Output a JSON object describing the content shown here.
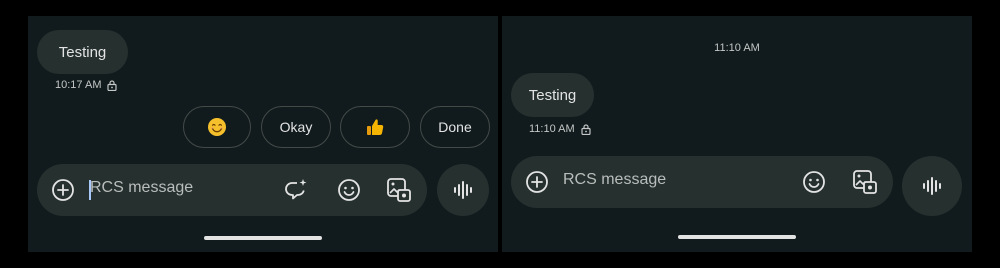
{
  "left": {
    "message": {
      "text": "Testing",
      "time": "10:17 AM"
    },
    "suggestions": [
      {
        "label": "😊",
        "icon": "smile-emoji"
      },
      {
        "label": "Okay"
      },
      {
        "label": "👍",
        "icon": "thumbs-up-emoji"
      },
      {
        "label": "Done"
      }
    ],
    "composer": {
      "placeholder": "RCS message",
      "icons": [
        "add-circle-icon",
        "ai-sparkle-chat-icon",
        "emoji-icon",
        "gallery-icon"
      ]
    },
    "voice_icon": "voice-waveform-icon"
  },
  "right": {
    "timestamp_header": "11:10 AM",
    "message": {
      "text": "Testing",
      "time": "11:10 AM"
    },
    "composer": {
      "placeholder": "RCS message",
      "icons": [
        "add-circle-icon",
        "emoji-icon",
        "gallery-icon"
      ]
    },
    "voice_icon": "voice-waveform-icon"
  },
  "colors": {
    "panel_bg": "#111b1d",
    "bubble_bg": "#25302f",
    "text": "#e3e3e3",
    "secondary_text": "#c4c7c5",
    "cursor": "#a8c7fa",
    "thumbs_up": "#f5b400"
  }
}
